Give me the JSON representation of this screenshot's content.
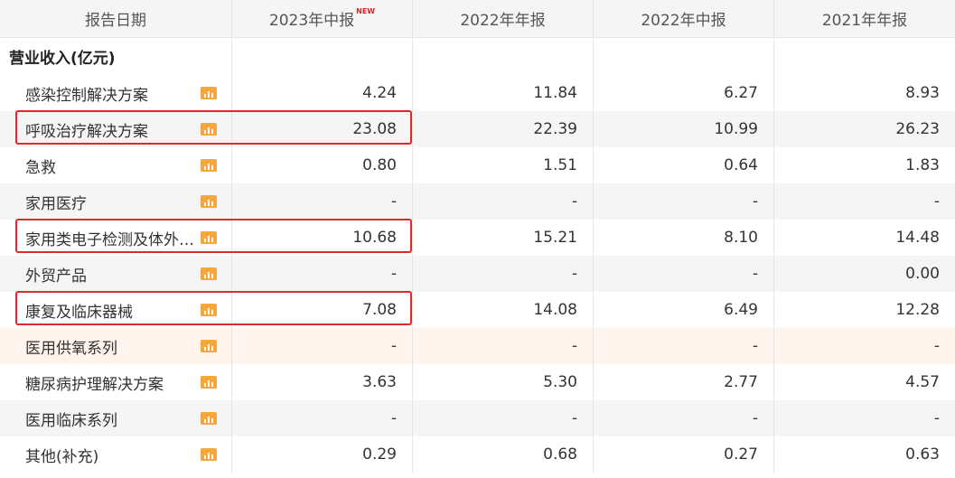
{
  "header": {
    "col0": "报告日期",
    "col1": "2023年中报",
    "col1_badge": "NEW",
    "col2": "2022年年报",
    "col3": "2022年中报",
    "col4": "2021年年报"
  },
  "section": {
    "label": "营业收入(亿元)"
  },
  "rows": [
    {
      "label": "感染控制解决方案",
      "v": [
        "4.24",
        "11.84",
        "6.27",
        "8.93"
      ]
    },
    {
      "label": "呼吸治疗解决方案",
      "v": [
        "23.08",
        "22.39",
        "10.99",
        "26.23"
      ]
    },
    {
      "label": "急救",
      "v": [
        "0.80",
        "1.51",
        "0.64",
        "1.83"
      ]
    },
    {
      "label": "家用医疗",
      "v": [
        "-",
        "-",
        "-",
        "-"
      ]
    },
    {
      "label": "家用类电子检测及体外…",
      "v": [
        "10.68",
        "15.21",
        "8.10",
        "14.48"
      ]
    },
    {
      "label": "外贸产品",
      "v": [
        "-",
        "-",
        "-",
        "0.00"
      ]
    },
    {
      "label": "康复及临床器械",
      "v": [
        "7.08",
        "14.08",
        "6.49",
        "12.28"
      ]
    },
    {
      "label": "医用供氧系列",
      "v": [
        "-",
        "-",
        "-",
        "-"
      ]
    },
    {
      "label": "糖尿病护理解决方案",
      "v": [
        "3.63",
        "5.30",
        "2.77",
        "4.57"
      ]
    },
    {
      "label": "医用临床系列",
      "v": [
        "-",
        "-",
        "-",
        "-"
      ]
    },
    {
      "label": "其他(补充)",
      "v": [
        "0.29",
        "0.68",
        "0.27",
        "0.63"
      ]
    }
  ],
  "colors": {
    "highlight_box": "#e02a2a",
    "chart_icon": "#f3a63b",
    "hover_row": "#fff4ec"
  }
}
